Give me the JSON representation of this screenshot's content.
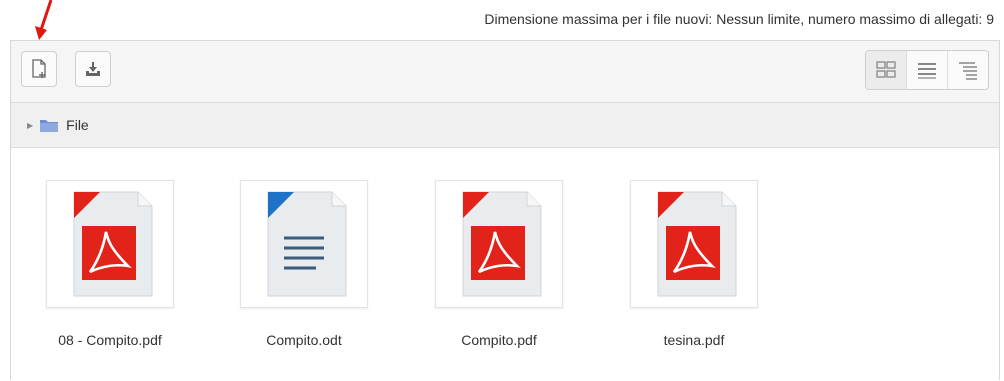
{
  "header": {
    "limits_text": "Dimensione massima per i file nuovi: Nessun limite, numero massimo di allegati: 9"
  },
  "toolbar": {
    "add_file_icon": "add-file-icon",
    "download_icon": "download-icon",
    "views": [
      "grid-view-icon",
      "list-view-icon",
      "tree-view-icon"
    ],
    "active_view": "grid-view-icon"
  },
  "path": {
    "folder_label": "File"
  },
  "files": [
    {
      "name": "08 - Compito.pdf",
      "type": "pdf"
    },
    {
      "name": "Compito.odt",
      "type": "document"
    },
    {
      "name": "Compito.pdf",
      "type": "pdf"
    },
    {
      "name": "tesina.pdf",
      "type": "pdf"
    }
  ],
  "colors": {
    "pdf_red": "#e2231a",
    "document_blue": "#1e73c8",
    "annotation_arrow": "#e3160f",
    "folder_blue": "#6f8fd1"
  }
}
